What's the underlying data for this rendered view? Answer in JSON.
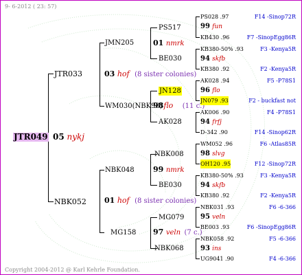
{
  "header": {
    "date": "9- 6-2012 ( 23: 57)"
  },
  "footer": {
    "copyright": "Copyright 2004-2012 @ Karl Kehrle Foundation."
  },
  "root": {
    "id": "JTR049",
    "num": "05",
    "breed": "nykj"
  },
  "gen1": {
    "father": {
      "id": "JTR033"
    },
    "mother": {
      "id": "NBK052",
      "num": "01",
      "breed": "hof",
      "note": "(8 sister colonies)"
    }
  },
  "gen2": {
    "ff": {
      "id": "JMN205"
    },
    "fm": {
      "id": "WM030(NBK98)",
      "num": "98",
      "breed": "flo",
      "note": "(11 c.)"
    },
    "f_mid": {
      "num": "03",
      "breed": "hof",
      "note": "(8 sister colonies)"
    },
    "mf": {
      "id": "NBK048"
    },
    "mm": {
      "id": "MG158",
      "num": "97",
      "breed": "veln",
      "note": "(7 c.)"
    }
  },
  "gen3": {
    "ps517": {
      "id": "PS517"
    },
    "jmn_mid": {
      "num": "01",
      "breed": "nmrk"
    },
    "be030a": {
      "id": "BE030"
    },
    "jn128": {
      "id": "JN128"
    },
    "ak028": {
      "id": "AK028"
    },
    "nbk008": {
      "id": "NBK008"
    },
    "nbk048_mid": {
      "num": "99",
      "breed": "nmrk"
    },
    "be030b": {
      "id": "BE030"
    },
    "mg079": {
      "id": "MG079"
    },
    "nbk068": {
      "id": "NBK068"
    }
  },
  "gen4": [
    {
      "id": "PS028 .97",
      "src": "F14 -Sinop72R"
    },
    {
      "mid": "99",
      "breed": "fun"
    },
    {
      "id": "KB430 .96",
      "src": "F7 -SinopEgg86R"
    },
    {
      "id": "KB380-50% .93",
      "src": "F3 -Kenya5R"
    },
    {
      "mid": "94",
      "breed": "skfb"
    },
    {
      "id": "KB380 .92",
      "src": "F2 -Kenya5R"
    },
    {
      "id": "AK028 .94",
      "src": "F5 -P78S1"
    },
    {
      "mid": "96",
      "breed": "flo"
    },
    {
      "id": "JN079 .93",
      "src": "F2 - buckfast not"
    },
    {
      "id": "AK006 .90",
      "src": "F4 -P78S1"
    },
    {
      "mid": "94",
      "breed": "frfj"
    },
    {
      "id": "D-342 .90",
      "src": "F14 -Sinop62R"
    },
    {
      "id": "WM052 .96",
      "src": "F6 -Atlas85R"
    },
    {
      "mid": "98",
      "breed": "slvg"
    },
    {
      "id": "OH120 .95",
      "src": "F12 -Sinop72R"
    },
    {
      "id": "KB380-50% .93",
      "src": "F3 -Kenya5R"
    },
    {
      "mid": "94",
      "breed": "skfb"
    },
    {
      "id": "KB380 .92",
      "src": "F2 -Kenya5R"
    },
    {
      "id": "NBK031 .93",
      "src": "F6 -6-366"
    },
    {
      "mid": "95",
      "breed": "veln"
    },
    {
      "id": "BE003 .93",
      "src": "F6 -SinopEgg86R"
    },
    {
      "id": "NBK058 .92",
      "src": "F5 -6-366"
    },
    {
      "mid": "93",
      "breed": "ins"
    },
    {
      "id": "UG9041 .90",
      "src": "F4 -6-366"
    }
  ],
  "colors": {
    "border": "#c000c0",
    "root_bg": "#e6b8f0",
    "highlight": "#ffff00",
    "source": "#0000cc",
    "breed": "#cc0000",
    "note": "#7a2fb0"
  }
}
